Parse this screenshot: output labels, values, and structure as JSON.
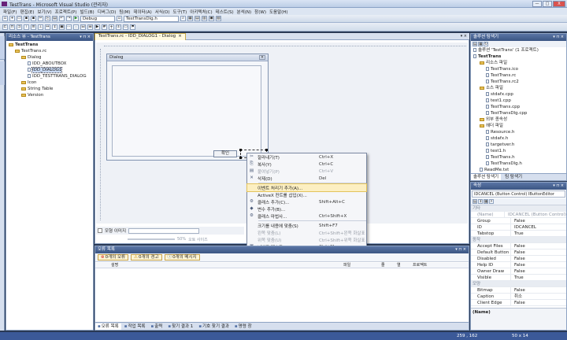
{
  "window": {
    "title": "TestTrans - Microsoft Visual Studio (관리자)",
    "min": "—",
    "max": "□",
    "close": "X"
  },
  "menu": [
    "파일(F)",
    "편집(E)",
    "보기(V)",
    "프로젝트(P)",
    "빌드(B)",
    "디버그(D)",
    "팀(M)",
    "데이터(A)",
    "서식(O)",
    "도구(T)",
    "아키텍처(C)",
    "테스트(S)",
    "분석(N)",
    "창(W)",
    "도움말(H)"
  ],
  "toolbar": {
    "config": "Debug",
    "file": "TestTransDlg.h"
  },
  "resource_view": {
    "title": "리소스 뷰 - TestTrans",
    "items": [
      {
        "label": "TestTrans",
        "indent": 0,
        "bold": true
      },
      {
        "label": "TestTrans.rc",
        "indent": 1
      },
      {
        "label": "Dialog",
        "indent": 2
      },
      {
        "label": "IDD_ABOUTBOX",
        "indent": 3
      },
      {
        "label": "IDD_DIALOG1",
        "indent": 3,
        "selected": true
      },
      {
        "label": "IDD_TESTTRANS_DIALOG",
        "indent": 3
      },
      {
        "label": "Icon",
        "indent": 2
      },
      {
        "label": "String Table",
        "indent": 2
      },
      {
        "label": "Version",
        "indent": 2
      }
    ]
  },
  "doc": {
    "tab": "TestTrans.rc - IDD_DIALOG1 - Dialog",
    "close": "×"
  },
  "dialog": {
    "title": "Dialog",
    "ok_button": "확인"
  },
  "context_menu": [
    {
      "icon": "✂",
      "label": "잘라내기(T)",
      "shortcut": "Ctrl+X"
    },
    {
      "icon": "⎘",
      "label": "복사(Y)",
      "shortcut": "Ctrl+C"
    },
    {
      "icon": "▤",
      "label": "붙여넣기(P)",
      "shortcut": "Ctrl+V",
      "disabled": true
    },
    {
      "icon": "✕",
      "label": "삭제(D)",
      "shortcut": "Del"
    },
    {
      "sep": true
    },
    {
      "icon": "",
      "label": "이벤트 처리기 추가(A)...",
      "shortcut": "",
      "highlight": true
    },
    {
      "icon": "",
      "label": "ActiveX 컨트롤 삽입(X)...",
      "shortcut": ""
    },
    {
      "icon": "⚙",
      "label": "클래스 추가(C)...",
      "shortcut": "Shift+Alt+C"
    },
    {
      "icon": "◆",
      "label": "변수 추가(B)...",
      "shortcut": ""
    },
    {
      "icon": "⚙",
      "label": "클래스 마법사...",
      "shortcut": "Ctrl+Shift+X"
    },
    {
      "sep": true
    },
    {
      "icon": "",
      "label": "크기를 내용에 맞춤(S)",
      "shortcut": "Shift+F7"
    },
    {
      "icon": "",
      "label": "왼쪽 맞춤(L)",
      "shortcut": "Ctrl+Shift+왼쪽 화살표",
      "disabled": true
    },
    {
      "icon": "",
      "label": "위쪽 맞춤(U)",
      "shortcut": "Ctrl+Shift+위쪽 화살표",
      "disabled": true
    },
    {
      "icon": "▣",
      "label": "너비고 테스트(M)",
      "shortcut": "Ctrl+M"
    },
    {
      "sep": true
    },
    {
      "icon": "▦",
      "label": "속성(R)",
      "shortcut": ""
    }
  ],
  "guide": {
    "label": "모형 이미지",
    "percent": "50%",
    "zoom": "오토 사이즈"
  },
  "error_list": {
    "title": "오류 목록",
    "errors": "0개의 오류",
    "warnings": "0개의 경고",
    "messages": "0개의 메시지",
    "columns": [
      "설명",
      "파일",
      "줄",
      "열",
      "프로젝트"
    ]
  },
  "bottom_tabs": [
    "오류 목록",
    "작업 목록",
    "출력",
    "찾기 결과 1",
    "기호 찾기 결과",
    "명령 창"
  ],
  "solution_explorer": {
    "title": "솔루션 탐색기",
    "items": [
      {
        "label": "솔루션 'TestTrans' (1 프로젝트)",
        "indent": 0
      },
      {
        "label": "TestTrans",
        "indent": 0,
        "bold": true
      },
      {
        "label": "리소스 파일",
        "indent": 1,
        "folder": true
      },
      {
        "label": "TestTrans.ico",
        "indent": 2
      },
      {
        "label": "TestTrans.rc",
        "indent": 2
      },
      {
        "label": "TestTrans.rc2",
        "indent": 2
      },
      {
        "label": "소스 파일",
        "indent": 1,
        "folder": true
      },
      {
        "label": "stdafx.cpp",
        "indent": 2
      },
      {
        "label": "test1.cpp",
        "indent": 2
      },
      {
        "label": "TestTrans.cpp",
        "indent": 2
      },
      {
        "label": "TestTransDlg.cpp",
        "indent": 2
      },
      {
        "label": "외부 종속성",
        "indent": 1,
        "folder": true
      },
      {
        "label": "헤더 파일",
        "indent": 1,
        "folder": true
      },
      {
        "label": "Resource.h",
        "indent": 2
      },
      {
        "label": "stdafx.h",
        "indent": 2
      },
      {
        "label": "targetver.h",
        "indent": 2
      },
      {
        "label": "test1.h",
        "indent": 2
      },
      {
        "label": "TestTrans.h",
        "indent": 2
      },
      {
        "label": "TestTransDlg.h",
        "indent": 2
      },
      {
        "label": "ReadMe.txt",
        "indent": 1
      }
    ],
    "tabs": [
      "솔루션 탐색기",
      "팀 탐색기"
    ]
  },
  "properties": {
    "title": "속성",
    "target": "IDCANCEL (Button Control)  IButtonEditor",
    "rows": [
      {
        "cat": "기타"
      },
      {
        "k": "(Name)",
        "v": "IDCANCEL (Button Control)",
        "dim": true
      },
      {
        "k": "Group",
        "v": "False"
      },
      {
        "k": "ID",
        "v": "IDCANCEL"
      },
      {
        "k": "Tabstop",
        "v": "True"
      },
      {
        "cat": "동작"
      },
      {
        "k": "Accept Files",
        "v": "False"
      },
      {
        "k": "Default Button",
        "v": "False"
      },
      {
        "k": "Disabled",
        "v": "False"
      },
      {
        "k": "Help ID",
        "v": "False"
      },
      {
        "k": "Owner Draw",
        "v": "False"
      },
      {
        "k": "Visible",
        "v": "True"
      },
      {
        "cat": "모양"
      },
      {
        "k": "Bitmap",
        "v": "False"
      },
      {
        "k": "Caption",
        "v": "취소"
      },
      {
        "k": "Client Edge",
        "v": "False"
      }
    ],
    "footer": "(Name)"
  },
  "status": {
    "pos": "259 , 162",
    "size": "50 x 14"
  }
}
